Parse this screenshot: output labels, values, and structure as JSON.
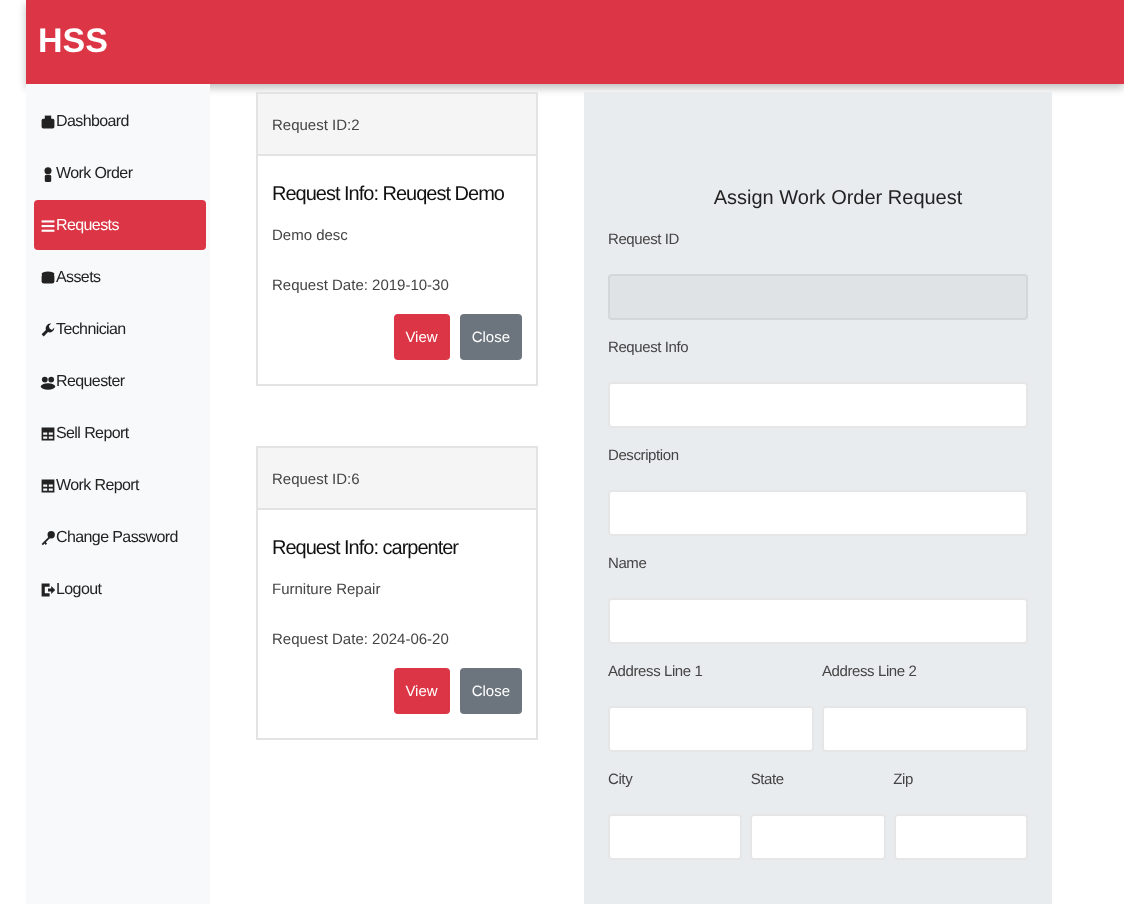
{
  "header": {
    "brand": "HSS"
  },
  "sidebar": {
    "items": [
      {
        "label": "Dashboard",
        "selected": false
      },
      {
        "label": "Work Order",
        "selected": false
      },
      {
        "label": "Requests",
        "selected": true
      },
      {
        "label": "Assets",
        "selected": false
      },
      {
        "label": "Technician",
        "selected": false
      },
      {
        "label": "Requester",
        "selected": false
      },
      {
        "label": "Sell Report",
        "selected": false
      },
      {
        "label": "Work Report",
        "selected": false
      },
      {
        "label": "Change Password",
        "selected": false
      },
      {
        "label": "Logout",
        "selected": false
      }
    ]
  },
  "requests": [
    {
      "header": "Request ID:2",
      "title": "Request Info: Reuqest Demo",
      "description": "Demo desc",
      "date": "Request Date: 2019-10-30",
      "buttons": [
        "View",
        "Close"
      ]
    },
    {
      "header": "Request ID:6",
      "title": "Request Info: carpenter",
      "description": "Furniture Repair",
      "date": "Request Date: 2024-06-20",
      "buttons": [
        "View",
        "Close"
      ]
    }
  ],
  "form": {
    "title": "Assign Work Order Request",
    "fields": [
      {
        "label": "Request ID",
        "kind": "full",
        "disabled": true
      },
      {
        "label": "Request Info",
        "kind": "full",
        "disabled": false
      },
      {
        "label": "Description",
        "kind": "full",
        "disabled": false
      },
      {
        "label": "Name",
        "kind": "full",
        "disabled": false
      },
      {
        "label": "Address Line 1",
        "kind": "half",
        "disabled": false
      },
      {
        "label": "Address Line 2",
        "kind": "half",
        "disabled": false
      },
      {
        "label": "City",
        "kind": "third",
        "disabled": false
      },
      {
        "label": "State",
        "kind": "third",
        "disabled": false
      },
      {
        "label": "Zip",
        "kind": "third",
        "disabled": false
      }
    ]
  }
}
